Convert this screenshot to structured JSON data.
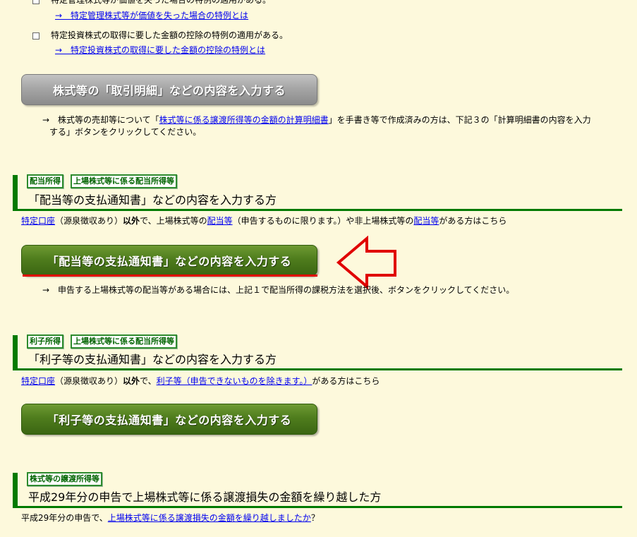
{
  "top": {
    "checkbox1_label": "特定管理株式等が価値を失った場合の特例の適用がある。",
    "link1": "→　特定管理株式等が価値を失った場合の特例とは",
    "checkbox2_label": "特定投資株式の取得に要した金額の控除の特例の適用がある。",
    "link2": "→　特定投資株式の取得に要した金額の控除の特例とは"
  },
  "transaction": {
    "button_label": "株式等の「取引明細」などの内容を入力する",
    "note_arrow": "→",
    "note_pre": "株式等の売却等について「",
    "note_link": "株式等に係る譲渡所得等の金額の計算明細書",
    "note_post1": "」を手書き等で作成済みの方は、下記３の「計算明細書の内容を入力",
    "note_post2": "する」ボタンをクリックしてください。"
  },
  "dividend": {
    "tag1": "配当所得",
    "tag2": "上場株式等に係る配当所得等",
    "title": "「配当等の支払通知書」などの内容を入力する方",
    "desc_link1": "特定口座",
    "desc_t1": "（源泉徴収あり）",
    "desc_bold": "以外",
    "desc_t2": "で、上場株式等の",
    "desc_link2": "配当等",
    "desc_t3": "（申告するものに限ります。）や非上場株式等の",
    "desc_link3": "配当等",
    "desc_t4": "がある方はこちら",
    "button_label": "「配当等の支払通知書」などの内容を入力する",
    "note_arrow": "→",
    "note": "申告する上場株式等の配当等がある場合には、上記１で配当所得の課税方法を選択後、ボタンをクリックしてください。"
  },
  "interest": {
    "tag1": "利子所得",
    "tag2": "上場株式等に係る配当所得等",
    "title": "「利子等の支払通知書」などの内容を入力する方",
    "desc_link1": "特定口座",
    "desc_t1": "（源泉徴収あり）",
    "desc_bold": "以外",
    "desc_t2": "で、",
    "desc_link2": "利子等（申告できないものを除きます。）",
    "desc_t3": "がある方はこちら",
    "button_label": "「利子等の支払通知書」などの内容を入力する"
  },
  "carryover": {
    "tag1": "株式等の譲渡所得等",
    "title": "平成29年分の申告で上場株式等に係る譲渡損失の金額を繰り越した方",
    "desc_t1": "平成29年分の申告で、",
    "desc_link": "上場株式等に係る譲渡損失の金額を繰り越しましたか",
    "desc_t2": "？"
  },
  "colors": {
    "background": "#fdf9dc",
    "section_green": "#007a00",
    "button_green": "#4f7d1d",
    "button_gray": "#a6a6a6",
    "annotation_red": "#e00000"
  },
  "icons": {
    "pointer_arrow": "red-left-arrow-outline"
  }
}
